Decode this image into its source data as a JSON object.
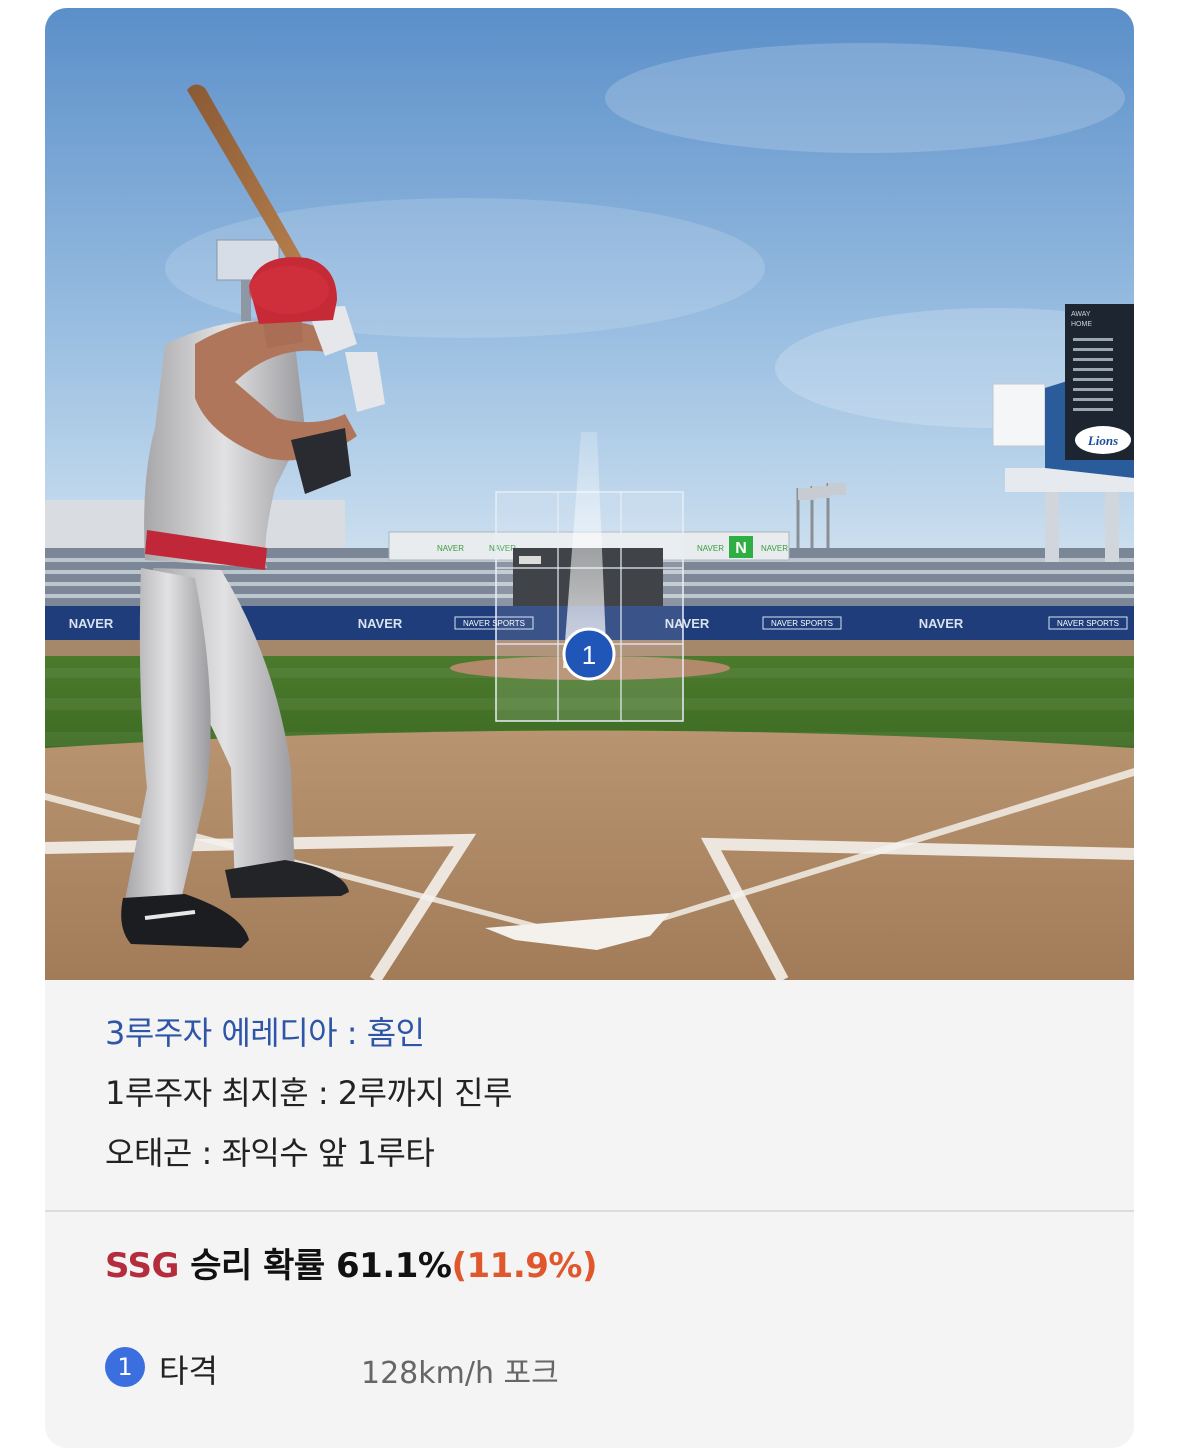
{
  "scene": {
    "ad_boards": [
      "NAVER",
      "NAVER",
      "NAVER",
      "NAVER"
    ],
    "sports_boards": [
      "NAVER SPORTS",
      "NAVER SPORTS",
      "NAVER SPORTS"
    ],
    "scoreboard_logo": "Lions",
    "scoreboard_rows": [
      "AWAY",
      "HOME"
    ],
    "top_boards": [
      "NAVER",
      "NAVER",
      "NAVER",
      "NAVER"
    ],
    "top_board_n": "N",
    "pitch_marker": "1",
    "icon_names": [
      "pitch-location-marker",
      "strike-zone-grid"
    ]
  },
  "play": {
    "lines": [
      "3루주자 에레디아 : 홈인",
      "1루주자 최지훈 : 2루까지 진루",
      "오태곤 : 좌익수 앞 1루타"
    ]
  },
  "win_probability": {
    "team": "SSG",
    "label": "승리 확률",
    "value": "61.1%",
    "delta": "(11.9%)"
  },
  "pitch": {
    "number": "1",
    "result": "타격",
    "detail": "128km/h  포크"
  },
  "colors": {
    "accent_blue": "#2e55a7",
    "team_red": "#b32d3c",
    "delta_orange": "#e0572d",
    "marker_blue": "#1f56b8"
  }
}
